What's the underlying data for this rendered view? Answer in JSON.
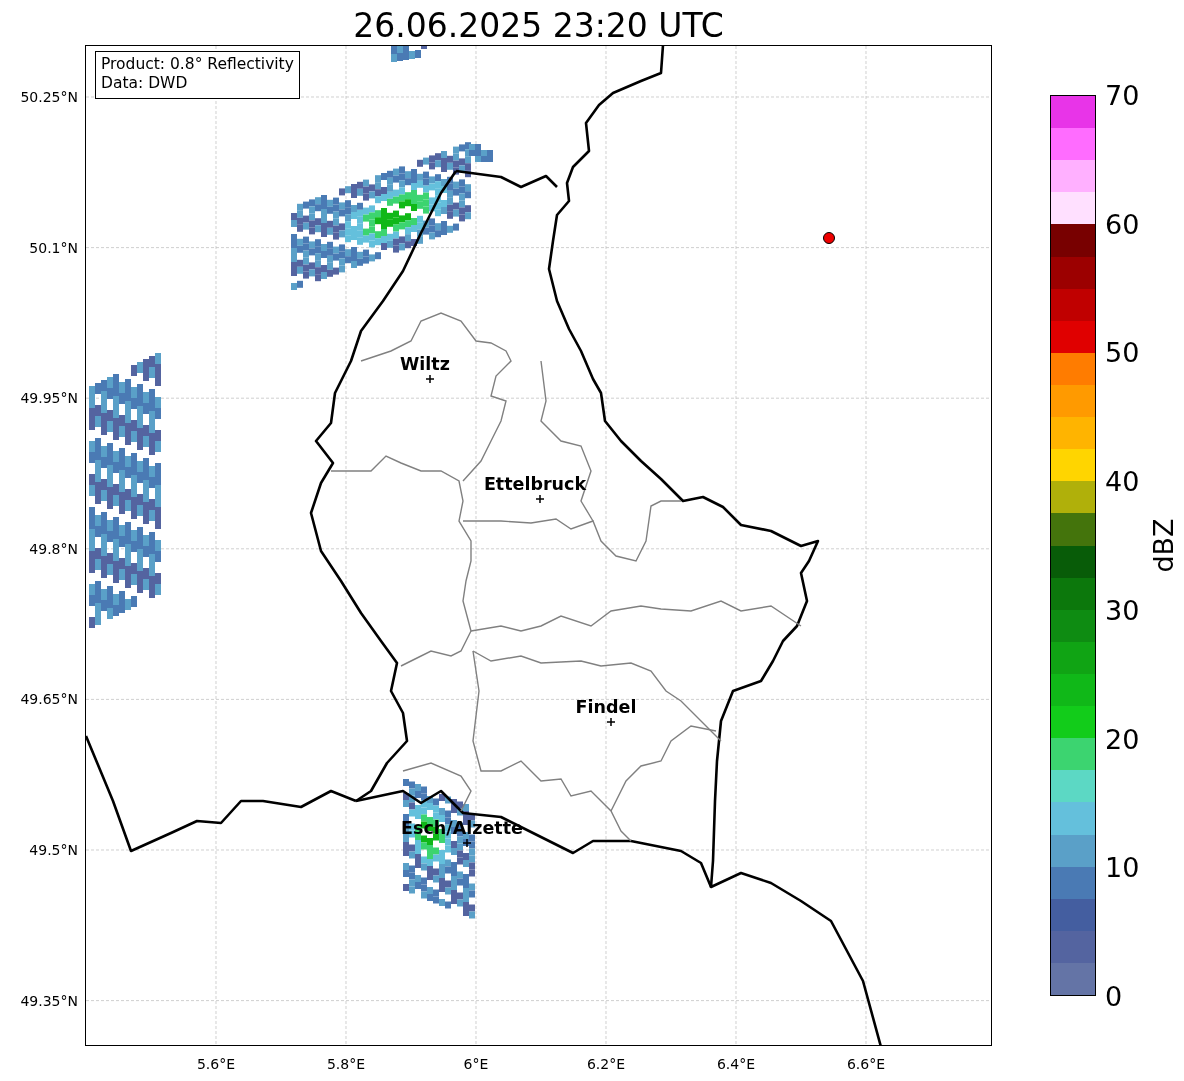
{
  "title": "26.06.2025 23:20 UTC",
  "info_box": [
    "Product: 0.8° Reflectivity",
    "Data: DWD"
  ],
  "y_ticks": [
    "50.25°N",
    "50.1°N",
    "49.95°N",
    "49.8°N",
    "49.65°N",
    "49.5°N",
    "49.35°N"
  ],
  "x_ticks": [
    "5.6°E",
    "5.8°E",
    "6°E",
    "6.2°E",
    "6.4°E",
    "6.6°E"
  ],
  "cities": [
    {
      "name": "Wiltz"
    },
    {
      "name": "Ettelbruck"
    },
    {
      "name": "Findel"
    },
    {
      "name": "Esch/Alzette"
    }
  ],
  "colorbar": {
    "label": "dBZ",
    "ticks": [
      "70",
      "60",
      "50",
      "40",
      "30",
      "20",
      "10",
      "0"
    ],
    "bins": [
      {
        "color": "#e834e8"
      },
      {
        "color": "#ff6cff"
      },
      {
        "color": "#ffb0ff"
      },
      {
        "color": "#ffe0ff"
      },
      {
        "color": "#780000"
      },
      {
        "color": "#9c0000"
      },
      {
        "color": "#c00000"
      },
      {
        "color": "#e00000"
      },
      {
        "color": "#ff7c00"
      },
      {
        "color": "#ff9a00"
      },
      {
        "color": "#ffb400"
      },
      {
        "color": "#ffd500"
      },
      {
        "color": "#b0b00a"
      },
      {
        "color": "#44740c"
      },
      {
        "color": "#085c08"
      },
      {
        "color": "#0c780c"
      },
      {
        "color": "#0e8c12"
      },
      {
        "color": "#10a414"
      },
      {
        "color": "#10b818"
      },
      {
        "color": "#12cc1a"
      },
      {
        "color": "#3cd470"
      },
      {
        "color": "#5cd8c4"
      },
      {
        "color": "#64c0dc"
      },
      {
        "color": "#5aa0c8"
      },
      {
        "color": "#4a7ab4"
      },
      {
        "color": "#445ea0"
      },
      {
        "color": "#5464a0"
      },
      {
        "color": "#6474a6"
      }
    ]
  }
}
